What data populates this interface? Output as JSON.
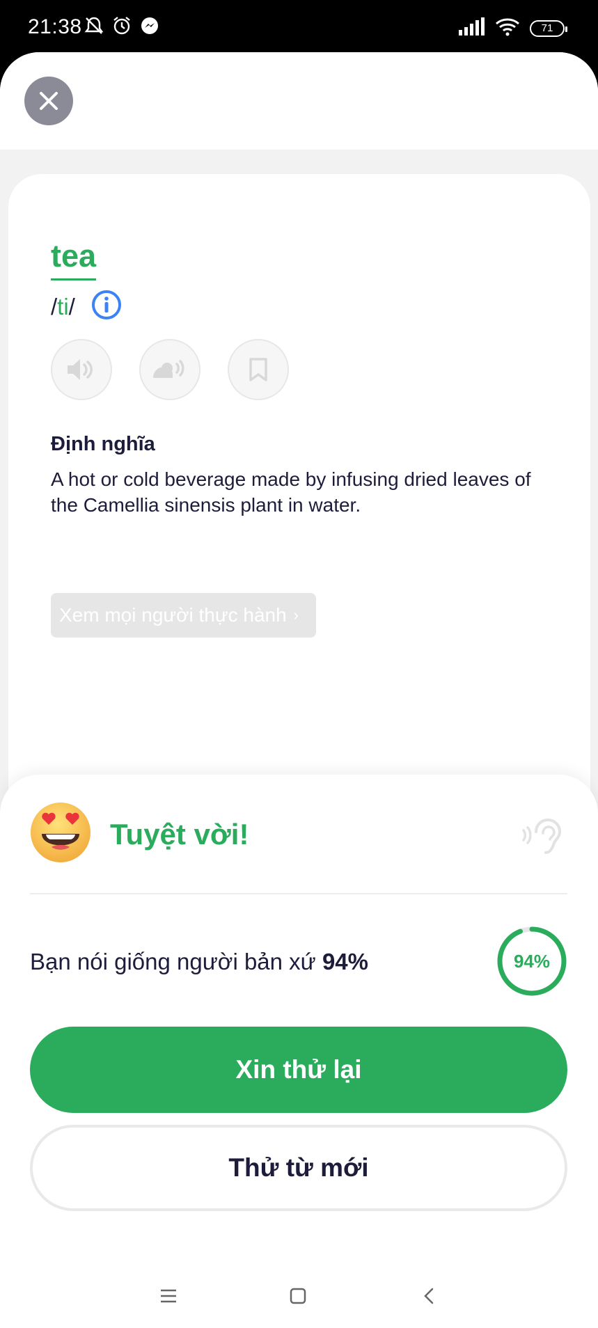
{
  "status_bar": {
    "time": "21:38",
    "battery": "71",
    "icons": [
      "mute-icon",
      "alarm-icon",
      "messenger-icon",
      "signal-icon",
      "wifi-icon",
      "battery-icon"
    ]
  },
  "word_card": {
    "word": "tea",
    "phonetic_open": "/",
    "phonetic_core": "ti",
    "phonetic_close": "/",
    "definition_title": "Định nghĩa",
    "definition_text": "A hot or cold beverage made by infusing dried leaves of the Camellia sinensis plant in water.",
    "practice_label": "Xem mọi người thực hành",
    "practice_chevron": "›"
  },
  "result": {
    "title": "Tuyệt vời!",
    "native_text_prefix": "Bạn nói giống người bản xứ ",
    "native_percent": "94%",
    "score_label": "94%",
    "score_fraction": 0.94,
    "retry_label": "Xin thử lại",
    "new_word_label": "Thử từ mới"
  },
  "colors": {
    "accent": "#2aac5c",
    "text": "#1d1d3b",
    "close_bg": "#8b8b98",
    "info_blue": "#3b82f6"
  }
}
